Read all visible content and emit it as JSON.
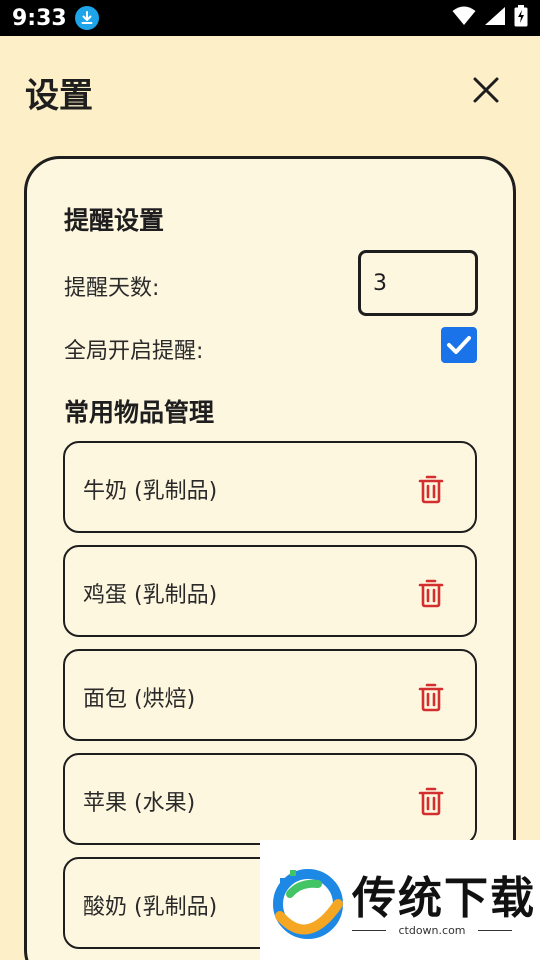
{
  "status_bar": {
    "time": "9:33",
    "icons": [
      "download-icon",
      "wifi-icon",
      "signal-icon",
      "battery-charging-icon"
    ]
  },
  "header": {
    "title": "设置",
    "close_icon": "close-icon"
  },
  "reminder_settings": {
    "title": "提醒设置",
    "days_label": "提醒天数:",
    "days_value": "3",
    "global_label": "全局开启提醒:",
    "global_enabled": true
  },
  "common_items": {
    "title": "常用物品管理",
    "items": [
      {
        "label": "牛奶 (乳制品)"
      },
      {
        "label": "鸡蛋 (乳制品)"
      },
      {
        "label": "面包 (烘焙)"
      },
      {
        "label": "苹果 (水果)"
      },
      {
        "label": "酸奶 (乳制品)"
      }
    ]
  },
  "watermark": {
    "text": "传统下载",
    "url": "ctdown.com"
  },
  "colors": {
    "background": "#fdefc8",
    "card": "#fef7e0",
    "accent": "#1a73e8",
    "delete": "#d32f2f"
  }
}
